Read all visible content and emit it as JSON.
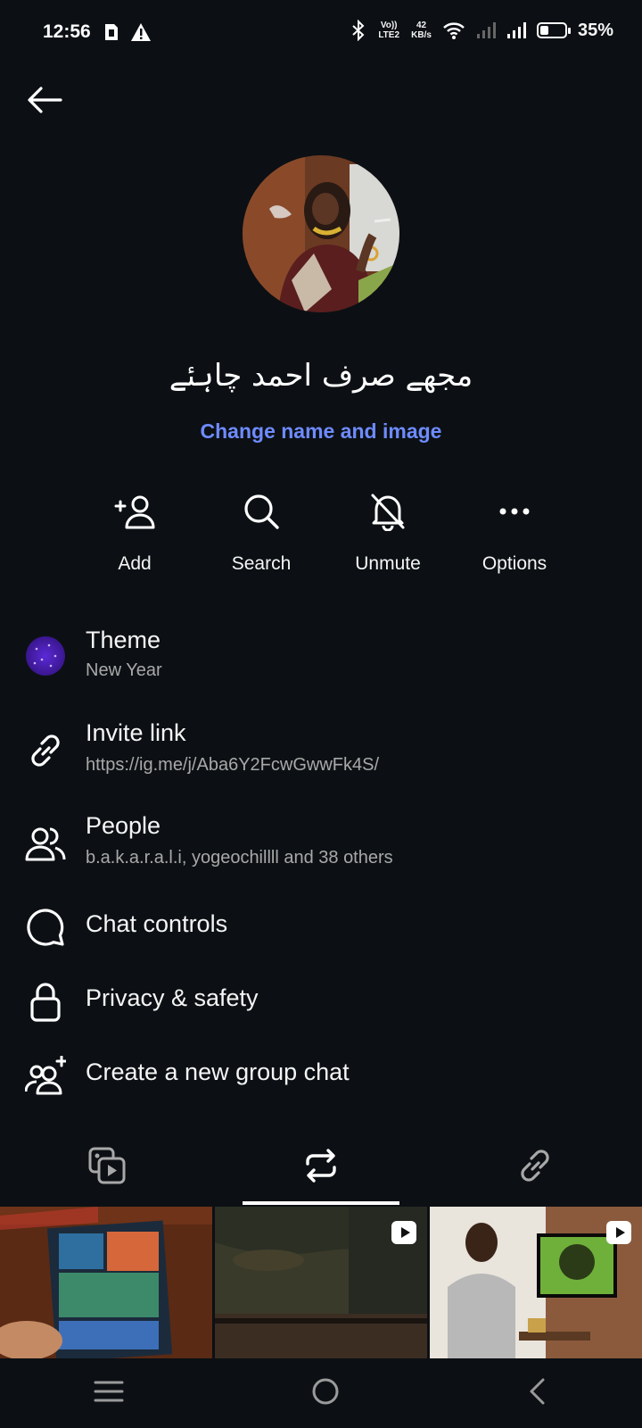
{
  "status_bar": {
    "time": "12:56",
    "volte": "Vo)) LTE2",
    "speed_value": "42",
    "speed_unit": "KB/s",
    "battery_percent": "35%",
    "battery_level": 0.35
  },
  "group": {
    "name": "مجھے صرف احمد چاہئے",
    "change_label": "Change name and image"
  },
  "actions": [
    {
      "label": "Add",
      "icon": "add-person-icon"
    },
    {
      "label": "Search",
      "icon": "search-icon"
    },
    {
      "label": "Unmute",
      "icon": "bell-off-icon"
    },
    {
      "label": "Options",
      "icon": "more-horizontal-icon"
    }
  ],
  "menu": {
    "theme": {
      "title": "Theme",
      "subtitle": "New Year"
    },
    "invite": {
      "title": "Invite link",
      "subtitle": "https://ig.me/j/Aba6Y2FcwGwwFk4S/"
    },
    "people": {
      "title": "People",
      "subtitle": "b.a.k.a.r.a.l.i, yogeochillll and 38 others"
    },
    "chat_controls": {
      "title": "Chat controls"
    },
    "privacy": {
      "title": "Privacy & safety"
    },
    "create_group": {
      "title": "Create a new group chat"
    }
  },
  "media_tabs": [
    "media-icon",
    "reels-icon",
    "links-icon"
  ],
  "colors": {
    "background": "#0c1014",
    "accent_link": "#6e8bff"
  }
}
